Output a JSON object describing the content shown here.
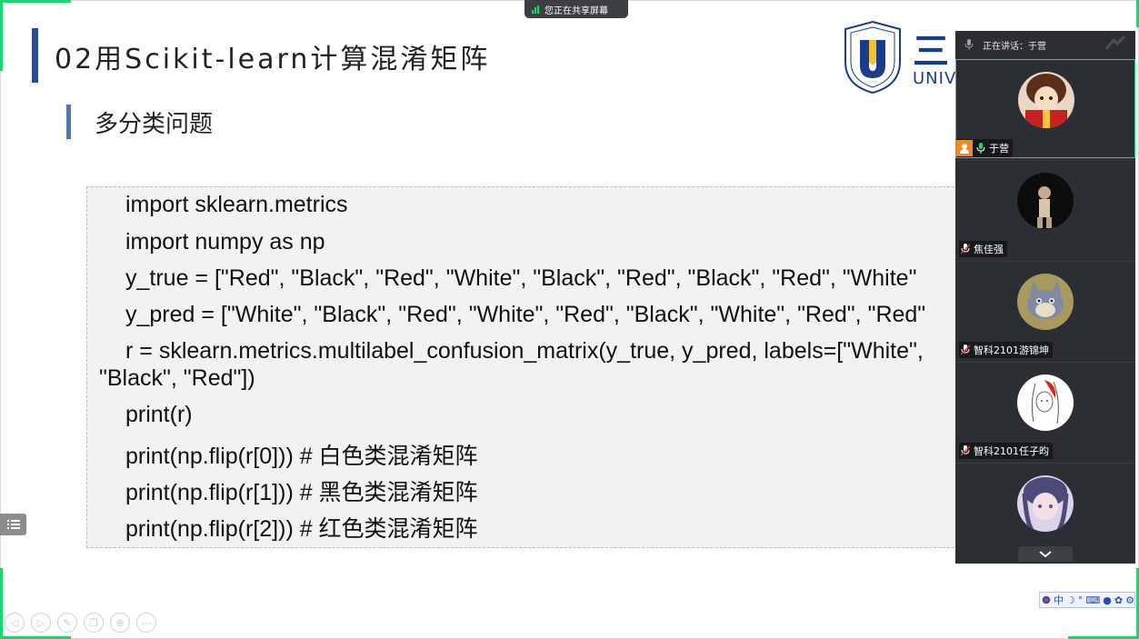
{
  "share_banner": {
    "text": "您正在共享屏幕",
    "icon": "signal-bars-icon"
  },
  "slide": {
    "title": "02用Scikit-learn计算混淆矩阵",
    "subtitle": "多分类问题",
    "logo": {
      "cn_text": "三亚学院",
      "en_text": "UNIV"
    },
    "code_lines": [
      "import sklearn.metrics",
      "import numpy as np",
      "y_true = [\"Red\", \"Black\", \"Red\", \"White\", \"Black\", \"Red\", \"Black\", \"Red\", \"White\"",
      "y_pred = [\"White\", \"Black\", \"Red\", \"White\", \"Red\", \"Black\", \"White\", \"Red\", \"Red\"",
      "r = sklearn.metrics.multilabel_confusion_matrix(y_true, y_pred, labels=[\"White\",",
      "\"Black\", \"Red\"])",
      "print(r)",
      "print(np.flip(r[0])) # 白色类混淆矩阵",
      "print(np.flip(r[1])) # 黑色类混淆矩阵",
      "print(np.flip(r[2])) # 红色类混淆矩阵"
    ]
  },
  "participants_panel": {
    "speaking_label": "正在讲话：于营",
    "participants": [
      {
        "name": "于营",
        "host": true,
        "muted": false,
        "avatar": "anime-girl-red-avatar"
      },
      {
        "name": "焦佳强",
        "host": false,
        "muted": true,
        "avatar": "dark-figure-avatar"
      },
      {
        "name": "智科2101游锦坤",
        "host": false,
        "muted": true,
        "avatar": "cartoon-cat-avatar"
      },
      {
        "name": "智科2101任子昀",
        "host": false,
        "muted": true,
        "avatar": "sketch-girl-avatar"
      },
      {
        "name": "",
        "host": false,
        "muted": true,
        "avatar": "anime-purple-avatar"
      }
    ],
    "scroll_icon": "chevron-down-icon"
  },
  "bottom_controls": [
    "prev-icon",
    "next-icon",
    "pen-icon",
    "copy-icon",
    "zoom-icon",
    "more-icon"
  ],
  "ime_toolbar": {
    "text": "中"
  },
  "colors": {
    "accent_green": "#1ad66e",
    "title_bar": "#1f4f9e",
    "subtitle_bar": "#4a78c0",
    "panel_bg": "#2b2e33",
    "host_orange": "#f08a24"
  }
}
